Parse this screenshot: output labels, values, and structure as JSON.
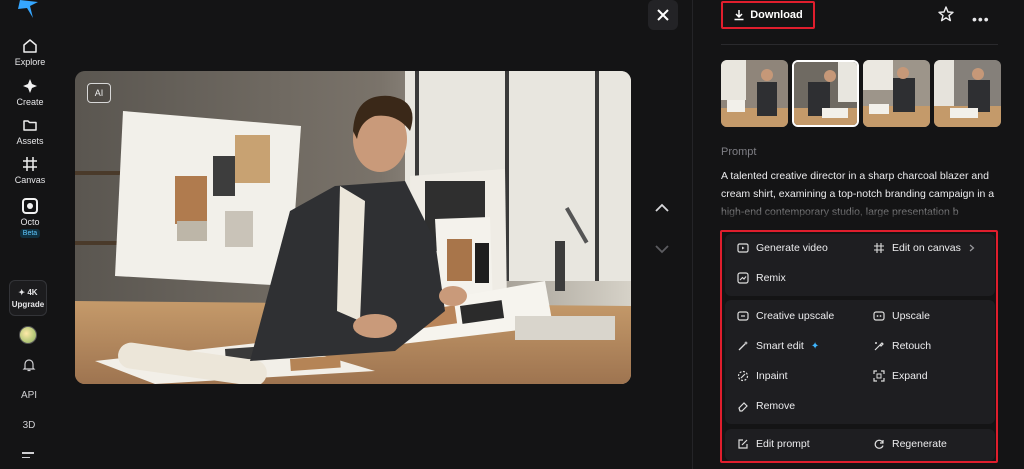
{
  "sidebar": {
    "items": [
      {
        "label": "Explore",
        "icon": "home-icon"
      },
      {
        "label": "Create",
        "icon": "sparkle-icon"
      },
      {
        "label": "Assets",
        "icon": "folder-icon"
      },
      {
        "label": "Canvas",
        "icon": "canvas-icon"
      },
      {
        "label": "Octo",
        "icon": "octo-icon"
      }
    ],
    "beta_label": "Beta",
    "upgrade": {
      "badge": "✦ 4K",
      "label": "Upgrade"
    },
    "api_label": "API",
    "threed_label": "3D"
  },
  "viewer": {
    "ai_badge": "AI"
  },
  "panel": {
    "download_label": "Download",
    "prompt_label": "Prompt",
    "prompt_text": "A talented creative director in a sharp charcoal blazer and cream shirt, examining a top-notch branding campaign in a high-end contemporary studio, large presentation b",
    "actions_group1": {
      "generate_video": "Generate video",
      "edit_on_canvas": "Edit on canvas",
      "remix": "Remix"
    },
    "actions_group2": {
      "creative_upscale": "Creative upscale",
      "upscale": "Upscale",
      "smart_edit": "Smart edit",
      "retouch": "Retouch",
      "inpaint": "Inpaint",
      "expand": "Expand",
      "remove": "Remove"
    },
    "actions_group3": {
      "edit_prompt": "Edit prompt",
      "regenerate": "Regenerate"
    }
  },
  "colors": {
    "accent_outline": "#e01e2d",
    "beta": "#5ec8ff",
    "background": "#141415"
  }
}
